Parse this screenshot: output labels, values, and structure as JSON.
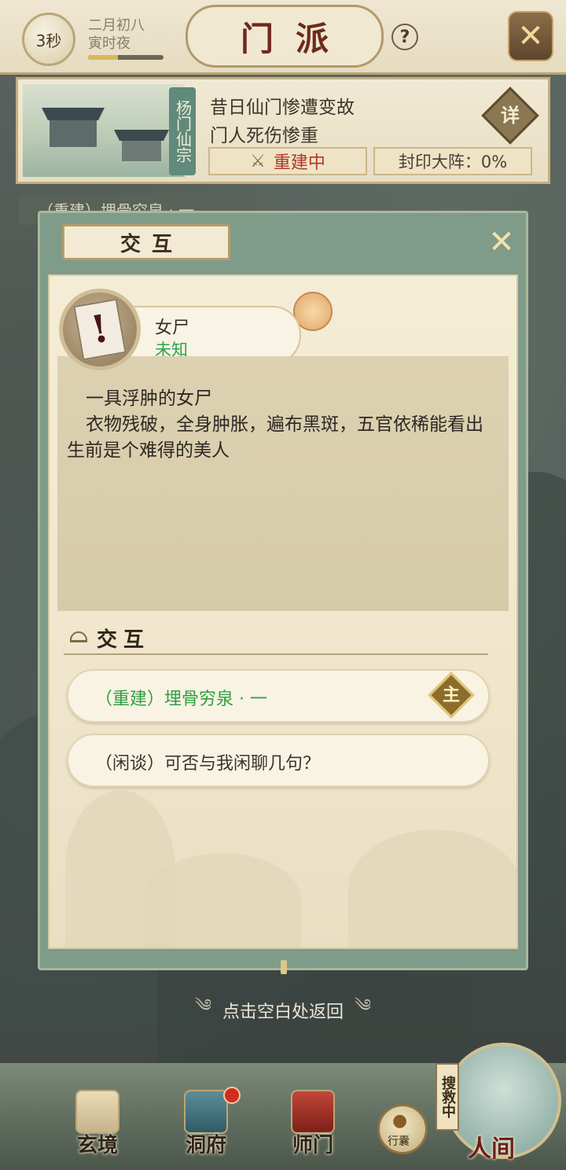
{
  "topbar": {
    "timer": "3秒",
    "date_line1": "二月初八",
    "date_line2": "寅时夜",
    "time_progress_percent": 40,
    "title": "门派",
    "help_icon": "question-icon",
    "close_icon": "crossed-swords-icon"
  },
  "sect": {
    "name_vertical": "杨门仙宗",
    "desc_line1": "昔日仙门惨遭变故",
    "desc_line2": "门人死伤惨重",
    "detail_label": "详",
    "status_label": "重建中",
    "seal_label": "封印大阵：0%"
  },
  "behind_tab": "（重建）埋骨穷泉 · 一",
  "dialog": {
    "title": "交互",
    "close_icon": "crossed-swords-icon",
    "npc": {
      "name": "女尸",
      "status": "未知",
      "portrait_icon": "exclamation-card-icon",
      "status_color": "#2fa34a"
    },
    "desc_line1": "一具浮肿的女尸",
    "desc_line2": "衣物残破，全身肿胀，遍布黑斑，五官依稀能看出生前是个难得的美人",
    "section_label": "交互",
    "options": [
      {
        "label": "（重建）埋骨穷泉 · 一",
        "badge": "主",
        "color": "#2f9f42"
      },
      {
        "label": "（闲谈）可否与我闲聊几句？",
        "color": "#3b332a"
      }
    ],
    "back_hint": "点击空白处返回"
  },
  "bottom_nav": {
    "items": [
      {
        "label": "玄境",
        "icon": "scroll-icon"
      },
      {
        "label": "洞府",
        "icon": "pavilion-icon",
        "has_notification": true
      },
      {
        "label": "师门",
        "icon": "banner-icon"
      }
    ],
    "bag_label": "行囊",
    "bag_icon": "pouch-icon",
    "search_tag": "搜救中",
    "world_label": "人间",
    "world_icon": "landscape-icon"
  }
}
